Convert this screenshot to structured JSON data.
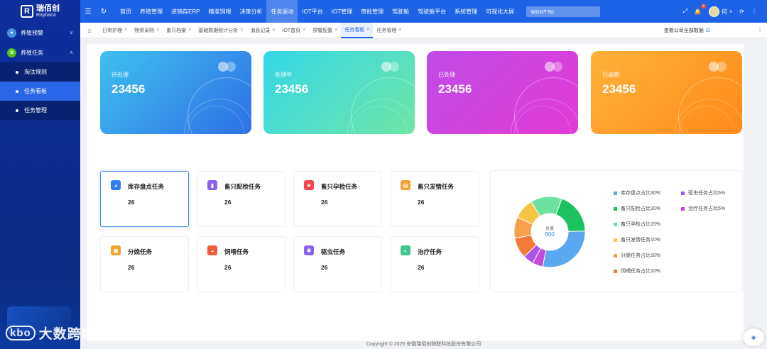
{
  "sidebar": {
    "logo_name": "瑞佰创",
    "logo_sub": "Raybaca",
    "logo_mark": "R",
    "groups": [
      {
        "label": "养殖预警",
        "icon": "user-icon",
        "color": "#4a90e2",
        "expanded": false
      },
      {
        "label": "养殖任务",
        "icon": "leaf-icon",
        "color": "#52c41a",
        "expanded": true
      }
    ],
    "sub_items": [
      {
        "label": "淘汰规则",
        "active": false
      },
      {
        "label": "任务看板",
        "active": true
      },
      {
        "label": "任务管理",
        "active": false
      }
    ]
  },
  "topbar": {
    "menu_icon": "☰",
    "refresh_icon": "↻",
    "nav": [
      {
        "label": "首页",
        "active": false
      },
      {
        "label": "养殖管理",
        "active": false
      },
      {
        "label": "进销存ERP",
        "active": false
      },
      {
        "label": "精准饲喂",
        "active": false
      },
      {
        "label": "决策分析",
        "active": false
      },
      {
        "label": "任务驱动",
        "active": true
      },
      {
        "label": "IOT平台",
        "active": false
      },
      {
        "label": "IOT管理",
        "active": false
      },
      {
        "label": "审批管理",
        "active": false
      },
      {
        "label": "驾驶舱",
        "active": false
      },
      {
        "label": "驾驶舱平台",
        "active": false
      },
      {
        "label": "系统管理",
        "active": false
      },
      {
        "label": "可视化大屏",
        "active": false
      }
    ],
    "search_placeholder": "瑞佰创牛场2",
    "fullscreen_icon": "⤢",
    "bell_icon": "🔔",
    "notification_count": "2",
    "user_name": "何",
    "user_arrow": "∨",
    "settings_icon": "⟳",
    "more_icon": "⋮"
  },
  "tabs": {
    "home_icon": "⌂",
    "close_glyph": "×",
    "items": [
      {
        "label": "日常护理",
        "active": false
      },
      {
        "label": "物资采购",
        "active": false
      },
      {
        "label": "畜只档案",
        "active": false
      },
      {
        "label": "基础数据统计分析",
        "active": false
      },
      {
        "label": "消息记录",
        "active": false
      },
      {
        "label": "IOT首页",
        "active": false
      },
      {
        "label": "预警配置",
        "active": false
      },
      {
        "label": "任务看板",
        "active": true
      },
      {
        "label": "任务管理",
        "active": false
      }
    ],
    "view_all": "查看公司全部数据",
    "view_all_check": "☑",
    "more": "⋮"
  },
  "stats": [
    {
      "label": "待处理",
      "value": "23456",
      "gradient": [
        "#3dc1f0",
        "#2f6fe6"
      ]
    },
    {
      "label": "处理中",
      "value": "23456",
      "gradient": [
        "#35d6e8",
        "#6ee6a6"
      ]
    },
    {
      "label": "已处理",
      "value": "23456",
      "gradient": [
        "#c04be8",
        "#e33ad4"
      ]
    },
    {
      "label": "已逾期",
      "value": "23456",
      "gradient": [
        "#ffb13a",
        "#ff8a1a"
      ]
    }
  ],
  "tasks": [
    {
      "title": "库存盘点任务",
      "count": "26",
      "icon": "inventory-icon",
      "color": "#2f7ff0",
      "glyph": "◕",
      "selected": true
    },
    {
      "title": "畜只配检任务",
      "count": "26",
      "icon": "mating-check-icon",
      "color": "#8a63e8",
      "glyph": "▮",
      "selected": false
    },
    {
      "title": "畜只孕检任务",
      "count": "26",
      "icon": "pregnancy-check-icon",
      "color": "#f0484e",
      "glyph": "★",
      "selected": false
    },
    {
      "title": "畜只发情任务",
      "count": "26",
      "icon": "estrus-icon",
      "color": "#f5a030",
      "glyph": "▤",
      "selected": false
    },
    {
      "title": "分娩任务",
      "count": "26",
      "icon": "calving-icon",
      "color": "#f5a030",
      "glyph": "▦",
      "selected": false
    },
    {
      "title": "饲喂任务",
      "count": "26",
      "icon": "feeding-icon",
      "color": "#f05a3a",
      "glyph": "◒",
      "selected": false
    },
    {
      "title": "驱虫任务",
      "count": "26",
      "icon": "deworming-icon",
      "color": "#8a63e8",
      "glyph": "✱",
      "selected": false
    },
    {
      "title": "治疗任务",
      "count": "26",
      "icon": "treatment-icon",
      "color": "#3cc88c",
      "glyph": "◐",
      "selected": false
    }
  ],
  "donut": {
    "center_label": "总量",
    "center_value": "600"
  },
  "chart_data": {
    "type": "pie",
    "title": "",
    "total": 600,
    "slices": [
      {
        "name": "库存盘点占比30%",
        "value": 30,
        "color": "#5aa9f0"
      },
      {
        "name": "畜只配检占比20%",
        "value": 20,
        "color": "#1cc25e"
      },
      {
        "name": "畜只孕检占比15%",
        "value": 15,
        "color": "#6ee0a0"
      },
      {
        "name": "畜只发情任务10%",
        "value": 10,
        "color": "#f7c546"
      },
      {
        "name": "分娩任务占比10%",
        "value": 10,
        "color": "#f7a04a"
      },
      {
        "name": "饲喂任务占比10%",
        "value": 10,
        "color": "#f47a3a"
      },
      {
        "name": "驱虫任务占比5%",
        "value": 5,
        "color": "#a657e6"
      },
      {
        "name": "治疗任务占比5%",
        "value": 5,
        "color": "#c24bd9"
      }
    ],
    "slice_order": [
      0,
      1,
      2,
      3,
      4,
      5,
      6,
      7
    ],
    "legend_order_col1": [
      0,
      1,
      2,
      3,
      4,
      5
    ],
    "legend_order_col2": [
      6,
      7
    ]
  },
  "footer": {
    "copyright": "Copyright © 2025 安徽瑞佰创物联科技股份有限公司"
  },
  "watermark": {
    "logo": "kbo",
    "text": "大数跨境"
  }
}
